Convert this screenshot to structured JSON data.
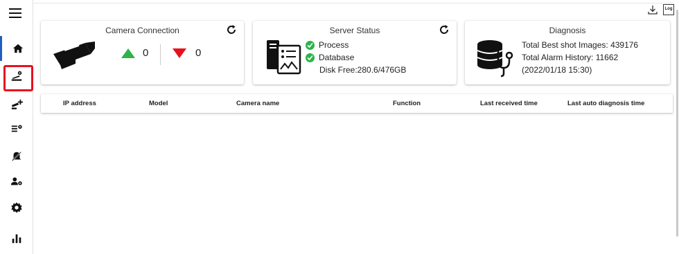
{
  "sidebar": {
    "items": [
      {
        "icon": "home-icon"
      },
      {
        "icon": "camera-settings-icon"
      },
      {
        "icon": "add-camera-icon"
      },
      {
        "icon": "camera-list-settings-icon"
      },
      {
        "icon": "alarm-icon"
      },
      {
        "icon": "user-settings-icon"
      },
      {
        "icon": "gear-icon"
      },
      {
        "icon": "bar-chart-icon"
      }
    ],
    "highlight_color": "#e8101e",
    "active_color": "#1f5fbf"
  },
  "cards": {
    "camera": {
      "title": "Camera Connection",
      "up_count": "0",
      "down_count": "0",
      "up_color": "#2db34a",
      "down_color": "#e8101e"
    },
    "server": {
      "title": "Server Status",
      "process_label": "Process",
      "database_label": "Database",
      "disk_free": "Disk Free:280.6/476GB",
      "ok_color": "#2db34a"
    },
    "diagnosis": {
      "title": "Diagnosis",
      "best_shot": "Total Best shot Images: 439176",
      "alarm_history": "Total Alarm History: 11662",
      "date": "(2022/01/18 15:30)"
    }
  },
  "table": {
    "columns": [
      "IP address",
      "Model",
      "Camera name",
      "Function",
      "Last received time",
      "Last auto diagnosis time"
    ],
    "rows": []
  },
  "top_right": {
    "download_icon": "download-icon",
    "log_label": "Log"
  }
}
